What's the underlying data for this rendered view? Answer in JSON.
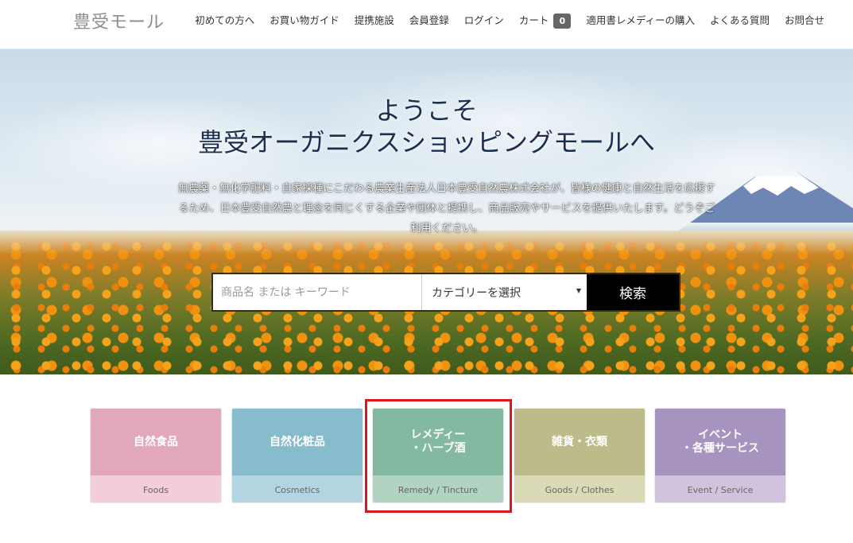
{
  "header": {
    "logo": "豊受モール",
    "nav": [
      {
        "label": "初めての方へ"
      },
      {
        "label": "お買い物ガイド"
      },
      {
        "label": "提携施設"
      },
      {
        "label": "会員登録"
      },
      {
        "label": "ログイン"
      },
      {
        "label": "カート",
        "badge": "0"
      },
      {
        "label": "適用書レメディーの購入"
      },
      {
        "label": "よくある質問"
      },
      {
        "label": "お問合せ"
      }
    ]
  },
  "hero": {
    "title_line1": "ようこそ",
    "title_line2": "豊受オーガニクスショッピングモールへ",
    "description": "無農薬・無化学肥料・自家採種にこだわる農業生産法人日本豊受自然農株式会社が、皆様の健康と自然生活を応援するため、日本豊受自然農と理念を同じくする企業や団体と提携し、商品販売やサービスを提供いたします。どうぞご利用ください。"
  },
  "search": {
    "placeholder": "商品名 または キーワード",
    "category_selected": "カテゴリーを選択",
    "button_label": "検索"
  },
  "categories": [
    {
      "title": "自然食品",
      "subtitle": "Foods",
      "color_top": "#e2a7b9",
      "color_bottom": "#f3cdd8"
    },
    {
      "title": "自然化粧品",
      "subtitle": "Cosmetics",
      "color_top": "#87bccc",
      "color_bottom": "#b3d5e1"
    },
    {
      "title": "レメディー\n・ハーブ酒",
      "subtitle": "Remedy / Tincture",
      "color_top": "#83b9a1",
      "color_bottom": "#b0d3c2"
    },
    {
      "title": "雑貨・衣類",
      "subtitle": "Goods / Clothes",
      "color_top": "#bcbb89",
      "color_bottom": "#dadab7"
    },
    {
      "title": "イベント\n・各種サービス",
      "subtitle": "Event / Service",
      "color_top": "#a793bf",
      "color_bottom": "#d1c3dd"
    }
  ],
  "highlight_color": "#e0141e"
}
